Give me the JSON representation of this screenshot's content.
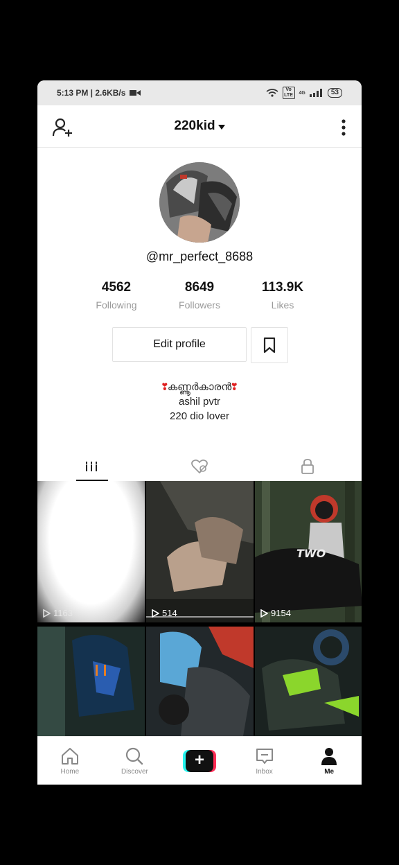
{
  "status_bar": {
    "time_speed": "5:13 PM | 2.6KB/s",
    "network": "4G",
    "volte": "Vo LTE",
    "battery": "53"
  },
  "header": {
    "title": "220kid"
  },
  "profile": {
    "handle": "@mr_perfect_8688",
    "stats": [
      {
        "value": "4562",
        "label": "Following"
      },
      {
        "value": "8649",
        "label": "Followers"
      },
      {
        "value": "113.9K",
        "label": "Likes"
      }
    ],
    "edit_label": "Edit profile",
    "bio": {
      "line1_heart_left": "❣",
      "line1_text": "കണ്ണൂർകാരൻ",
      "line1_heart_right": "❣",
      "line2": "ashil pvtr",
      "line3": "220 dio lover"
    }
  },
  "videos": [
    {
      "views": "1163"
    },
    {
      "views": "514"
    },
    {
      "views": "9154"
    },
    {
      "views": ""
    },
    {
      "views": ""
    },
    {
      "views": ""
    }
  ],
  "bottom_nav": {
    "home": "Home",
    "discover": "Discover",
    "create": "+",
    "inbox": "Inbox",
    "me": "Me"
  }
}
